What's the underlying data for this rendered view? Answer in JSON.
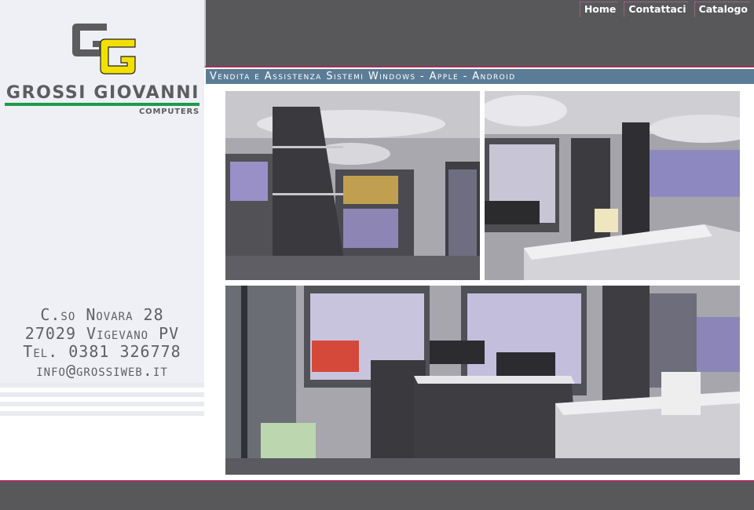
{
  "brand": {
    "name": "GROSSI GIOVANNI",
    "subtitle": "COMPUTERS",
    "logo_initials": "GG",
    "colors": {
      "gray": "#5d5d60",
      "yellow": "#f2e100",
      "green": "#1e9a4b"
    }
  },
  "nav": {
    "items": [
      {
        "label": "Home"
      },
      {
        "label": "Contattaci"
      },
      {
        "label": "Catalogo"
      }
    ]
  },
  "tagline": "Vendita e Assistenza Sistemi Windows - Apple - Android",
  "address": {
    "street": "C.so Novara 28",
    "city": "27029 Vigevano PV",
    "phone": "Tel. 0381 326778",
    "email": "info@grossiweb.it"
  },
  "colors": {
    "header": "#58585a",
    "accent_line": "#a03060",
    "tagline_bar": "#5b7c96",
    "sidebar": "#eef0f5"
  }
}
